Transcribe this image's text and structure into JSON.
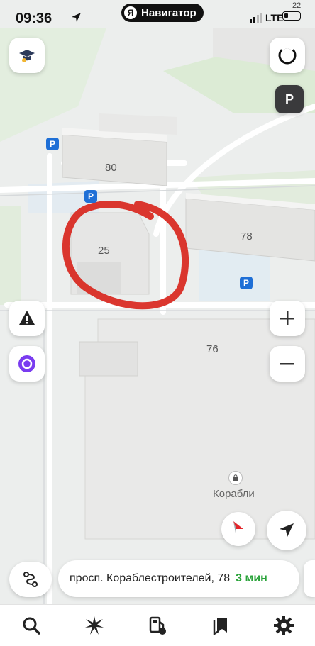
{
  "status_bar": {
    "time": "09:36",
    "app_name": "Навигатор",
    "app_badge": "Я",
    "network": "LTE",
    "battery_level": "22"
  },
  "map": {
    "buildings": {
      "b80": "80",
      "b78": "78",
      "b25": "25",
      "b76": "76"
    },
    "parking_label": "P",
    "poi": {
      "name": "Корабли",
      "icon": "shopping-bag-icon"
    },
    "annotation_color": "#d8261d"
  },
  "buttons": {
    "parking_layer": "P"
  },
  "route": {
    "address": "просп. Кораблестроителей, 78",
    "eta": "3 мин",
    "eta_color": "#2aa33a"
  },
  "bottom_nav": [
    {
      "icon": "search-icon"
    },
    {
      "icon": "explore-icon"
    },
    {
      "icon": "fuel-icon"
    },
    {
      "icon": "bookmarks-icon"
    },
    {
      "icon": "settings-icon"
    }
  ]
}
